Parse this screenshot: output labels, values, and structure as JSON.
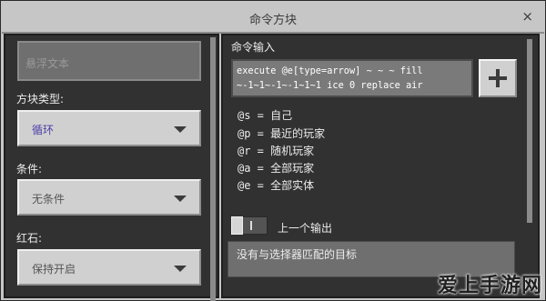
{
  "window": {
    "title": "命令方块",
    "close": "×"
  },
  "left": {
    "hover_placeholder": "悬浮文本",
    "block_type": {
      "label": "方块类型:",
      "value": "循环",
      "value_color": "#4d3ea6"
    },
    "condition": {
      "label": "条件:",
      "value": "无条件"
    },
    "redstone": {
      "label": "红石:",
      "value": "保持开启"
    }
  },
  "right": {
    "command_label": "命令输入",
    "command_lines": [
      "execute @e[type=arrow] ~ ~ ~ fill",
      "~-1~1~-1~-1~1~1 ice 0 replace air"
    ],
    "plus_icon": "plus-icon",
    "selectors": [
      "@s = 自己",
      "@p = 最近的玩家",
      "@r = 随机玩家",
      "@a = 全部玩家",
      "@e = 全部实体"
    ],
    "previous_output_label": "上一个输出",
    "output_text": "没有与选择器匹配的目标"
  },
  "watermark": "爱上手游网"
}
